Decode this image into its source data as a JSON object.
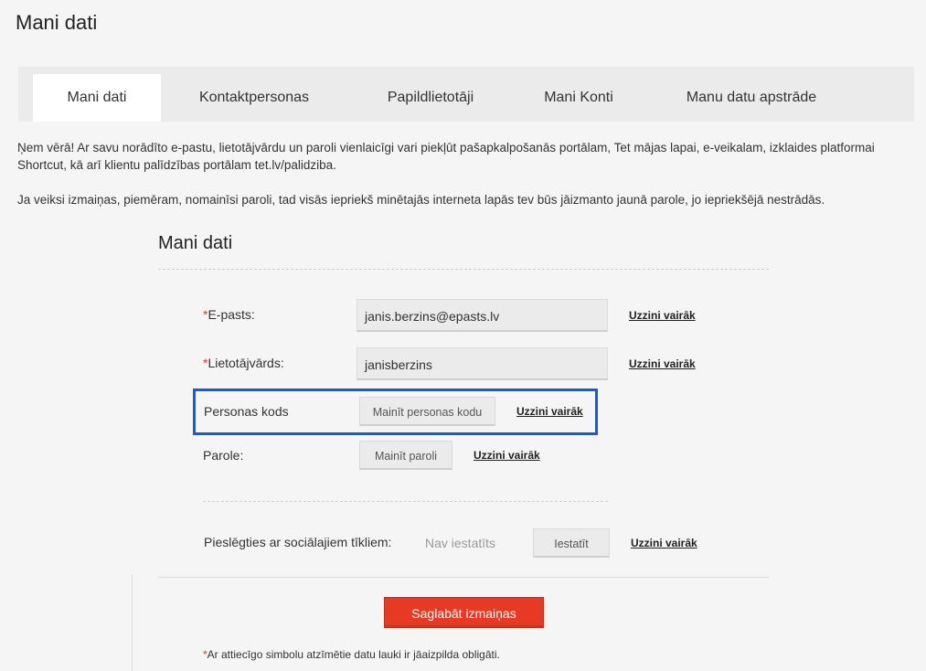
{
  "page_title": "Mani dati",
  "tabs": [
    {
      "label": "Mani dati",
      "active": true
    },
    {
      "label": "Kontaktpersonas"
    },
    {
      "label": "Papildlietotāji"
    },
    {
      "label": "Mani Konti"
    },
    {
      "label": "Manu datu apstrāde"
    }
  ],
  "notice": {
    "line1": "Ņem vērā! Ar savu norādīto e-pastu, lietotājvārdu un paroli vienlaicīgi vari piekļūt pašapkalpošanās portālam, Tet mājas lapai, e-veikalam, izklaides platformai Shortcut, kā arī klientu palīdzības portālam tet.lv/palidziba.",
    "line2": "Ja veiksi izmaiņas, piemēram, nomainīsi paroli, tad visās iepriekš minētajās interneta lapās tev būs jāizmanto jaunā parole, jo iepriekšējā nestrādās."
  },
  "section_title": "Mani dati",
  "required_mark": "*",
  "fields": {
    "email": {
      "label": "E-pasts:",
      "value": "janis.berzins@epasts.lv",
      "more": "Uzzini vairāk"
    },
    "username": {
      "label": "Lietotājvārds:",
      "value": "janisberzins",
      "more": "Uzzini vairāk"
    },
    "personal_code": {
      "label": "Personas kods",
      "button": "Mainīt personas kodu",
      "more": "Uzzini vairāk"
    },
    "password": {
      "label": "Parole:",
      "button": "Mainīt paroli",
      "more": "Uzzini vairāk"
    },
    "social": {
      "label": "Pieslēgties ar sociālajiem tīkliem:",
      "status": "Nav iestatīts",
      "button": "Iestatīt",
      "more": "Uzzini vairāk"
    }
  },
  "save_button": "Saglabāt izmaiņas",
  "footnote": "Ar attiecīgo simbolu atzīmētie datu lauki ir jāaizpilda obligāti.",
  "colors": {
    "accent_red": "#e73a24",
    "highlight_blue": "#0c5fe3"
  }
}
